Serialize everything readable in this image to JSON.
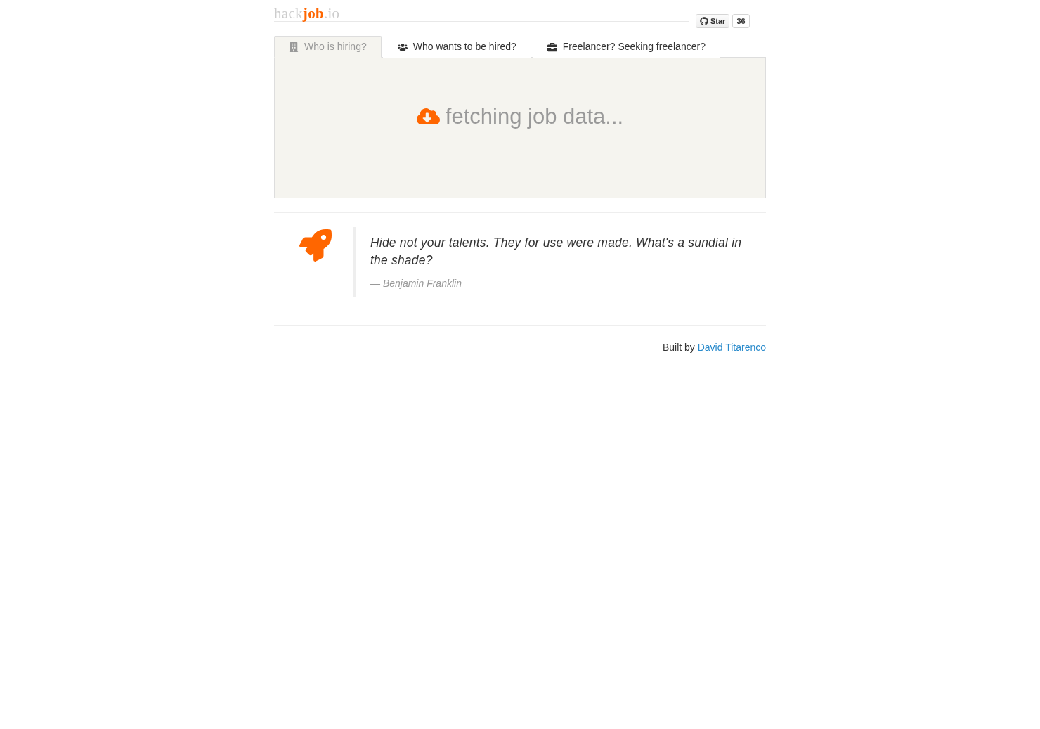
{
  "header": {
    "logo": [
      {
        "text": "hack",
        "highlight": false
      },
      {
        "text": "job",
        "highlight": true
      },
      {
        "text": ".io",
        "highlight": false
      }
    ],
    "github": {
      "label": "Star",
      "count": "36"
    }
  },
  "tabs": [
    {
      "label": "Who is hiring?",
      "selected": true
    },
    {
      "label": "Who wants to be hired?",
      "selected": false
    },
    {
      "label": "Freelancer? Seeking freelancer?",
      "selected": false
    }
  ],
  "panel": {
    "message": "fetching job data..."
  },
  "quote": {
    "text": "Hide not your talents. They for use were made. What's a sundial in the shade?",
    "author": "— Benjamin Franklin"
  },
  "footer": {
    "prefix": "Built by",
    "link": "David Titarenco"
  }
}
